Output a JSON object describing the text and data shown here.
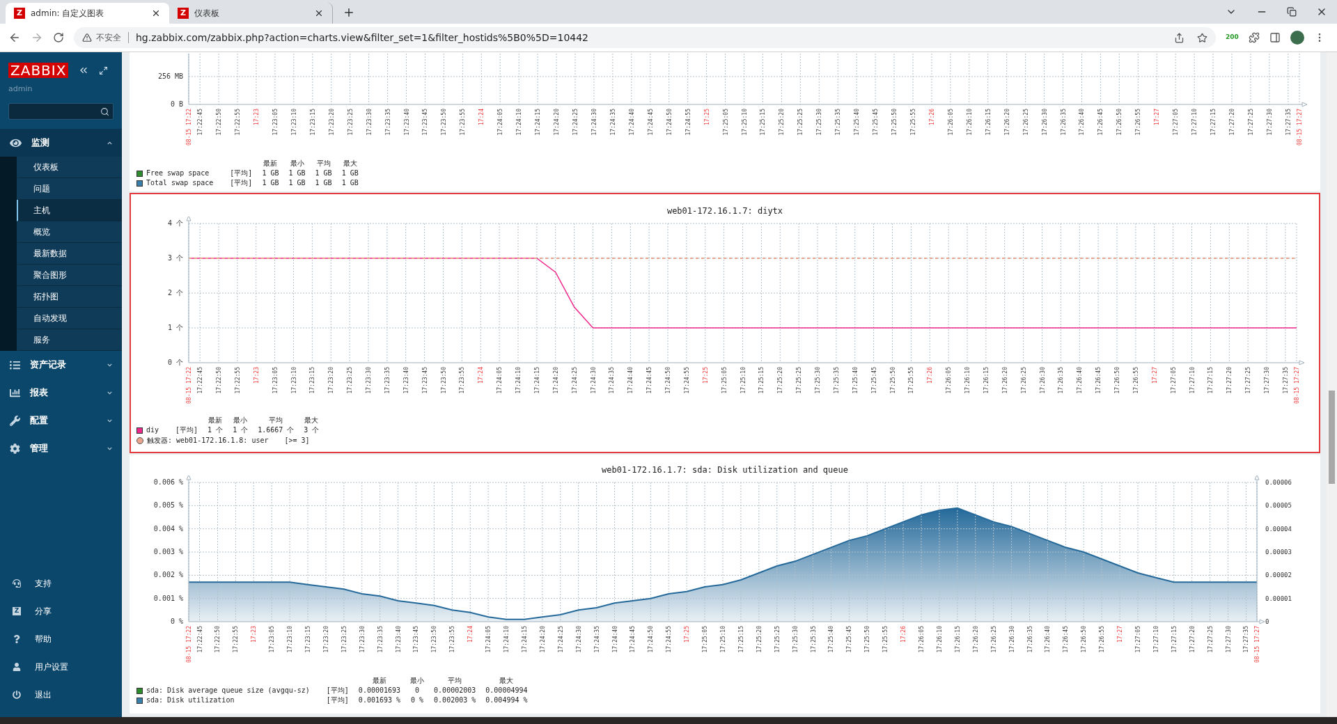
{
  "browser": {
    "tabs": [
      {
        "favicon": "Z",
        "title": "admin: 自定义图表",
        "selected": true
      },
      {
        "favicon": "Z",
        "title": "仪表板",
        "selected": false
      }
    ],
    "security": "不安全",
    "url": "hg.zabbix.com/zabbix.php?action=charts.view&filter_set=1&filter_hostids%5B0%5D=10442",
    "extension_badge": "200"
  },
  "sidebar": {
    "logo": "ZABBIX",
    "user": "admin",
    "sections": [
      {
        "label": "监测",
        "expanded": true,
        "children": [
          {
            "label": "仪表板",
            "selected": false
          },
          {
            "label": "问题",
            "selected": false
          },
          {
            "label": "主机",
            "selected": true
          },
          {
            "label": "概览",
            "selected": false
          },
          {
            "label": "最新数据",
            "selected": false
          },
          {
            "label": "聚合图形",
            "selected": false
          },
          {
            "label": "拓扑图",
            "selected": false
          },
          {
            "label": "自动发现",
            "selected": false
          },
          {
            "label": "服务",
            "selected": false
          }
        ]
      },
      {
        "label": "资产记录",
        "expanded": false
      },
      {
        "label": "报表",
        "expanded": false
      },
      {
        "label": "配置",
        "expanded": false
      },
      {
        "label": "管理",
        "expanded": false
      }
    ],
    "footer": [
      {
        "label": "支持"
      },
      {
        "label": "分享",
        "badge": "Z"
      },
      {
        "label": "帮助"
      },
      {
        "label": "用户设置"
      },
      {
        "label": "退出"
      }
    ]
  },
  "charts": [
    {
      "selected": false,
      "chart_data": {
        "type": "line",
        "grid": true,
        "ylim": [
          0,
          467
        ],
        "yticks": [
          {
            "value": 0,
            "label": "0 B"
          },
          {
            "value": 256,
            "label": "256 MB"
          }
        ],
        "categories": [
          "08-15 17:22",
          "17:22:45",
          "17:22:50",
          "17:22:55",
          "17:23",
          "17:23:05",
          "17:23:10",
          "17:23:15",
          "17:23:20",
          "17:23:25",
          "17:23:30",
          "17:23:35",
          "17:23:40",
          "17:23:45",
          "17:23:50",
          "17:23:55",
          "17:24",
          "17:24:05",
          "17:24:10",
          "17:24:15",
          "17:24:20",
          "17:24:25",
          "17:24:30",
          "17:24:35",
          "17:24:40",
          "17:24:45",
          "17:24:50",
          "17:24:55",
          "17:25",
          "17:25:05",
          "17:25:10",
          "17:25:15",
          "17:25:20",
          "17:25:25",
          "17:25:30",
          "17:25:35",
          "17:25:40",
          "17:25:45",
          "17:25:50",
          "17:25:55",
          "17:26",
          "17:26:05",
          "17:26:10",
          "17:26:15",
          "17:26:20",
          "17:26:25",
          "17:26:30",
          "17:26:35",
          "17:26:40",
          "17:26:45",
          "17:26:50",
          "17:26:55",
          "17:27",
          "17:27:05",
          "17:27:10",
          "17:27:15",
          "17:27:20",
          "17:27:25",
          "17:27:30",
          "17:27:35",
          "08-15 17:27"
        ]
      },
      "legend": {
        "headers": [
          "最新",
          "最小",
          "平均",
          "最大"
        ],
        "rows": [
          {
            "color": "#2e8b2e",
            "name": "Free swap space",
            "func": "[平均]",
            "values": [
              "1 GB",
              "1 GB",
              "1 GB",
              "1 GB"
            ]
          },
          {
            "color": "#3a7eaa",
            "name": "Total swap space",
            "func": "[平均]",
            "values": [
              "1 GB",
              "1 GB",
              "1 GB",
              "1 GB"
            ]
          }
        ]
      }
    },
    {
      "selected": true,
      "title": "web01-172.16.1.7: diytx",
      "chart_data": {
        "type": "line",
        "grid": true,
        "ylim": [
          0,
          4
        ],
        "yticks": [
          {
            "value": 0,
            "label": "0 个"
          },
          {
            "value": 1,
            "label": "1 个"
          },
          {
            "value": 2,
            "label": "2 个"
          },
          {
            "value": 3,
            "label": "3 个"
          },
          {
            "value": 4,
            "label": "4 个"
          }
        ],
        "categories": [
          "08-15 17:22",
          "17:22:45",
          "17:22:50",
          "17:22:55",
          "17:23",
          "17:23:05",
          "17:23:10",
          "17:23:15",
          "17:23:20",
          "17:23:25",
          "17:23:30",
          "17:23:35",
          "17:23:40",
          "17:23:45",
          "17:23:50",
          "17:23:55",
          "17:24",
          "17:24:05",
          "17:24:10",
          "17:24:15",
          "17:24:20",
          "17:24:25",
          "17:24:30",
          "17:24:35",
          "17:24:40",
          "17:24:45",
          "17:24:50",
          "17:24:55",
          "17:25",
          "17:25:05",
          "17:25:10",
          "17:25:15",
          "17:25:20",
          "17:25:25",
          "17:25:30",
          "17:25:35",
          "17:25:40",
          "17:25:45",
          "17:25:50",
          "17:25:55",
          "17:26",
          "17:26:05",
          "17:26:10",
          "17:26:15",
          "17:26:20",
          "17:26:25",
          "17:26:30",
          "17:26:35",
          "17:26:40",
          "17:26:45",
          "17:26:50",
          "17:26:55",
          "17:27",
          "17:27:05",
          "17:27:10",
          "17:27:15",
          "17:27:20",
          "17:27:25",
          "17:27:30",
          "17:27:35",
          "08-15 17:27"
        ],
        "series": [
          {
            "name": "diy",
            "color": "#f0288c",
            "values": [
              3,
              3,
              3,
              3,
              3,
              3,
              3,
              3,
              3,
              3,
              3,
              3,
              3,
              3,
              3,
              3,
              3,
              3,
              3,
              3,
              2.6,
              1.6,
              1,
              1,
              1,
              1,
              1,
              1,
              1,
              1,
              1,
              1,
              1,
              1,
              1,
              1,
              1,
              1,
              1,
              1,
              1,
              1,
              1,
              1,
              1,
              1,
              1,
              1,
              1,
              1,
              1,
              1,
              1,
              1,
              1,
              1,
              1,
              1,
              1,
              1,
              1
            ]
          },
          {
            "color": "#e8a58c",
            "line_style": "dashed",
            "values": [
              3,
              3,
              3,
              3,
              3,
              3,
              3,
              3,
              3,
              3,
              3,
              3,
              3,
              3,
              3,
              3,
              3,
              3,
              3,
              3,
              3,
              3,
              3,
              3,
              3,
              3,
              3,
              3,
              3,
              3,
              3,
              3,
              3,
              3,
              3,
              3,
              3,
              3,
              3,
              3,
              3,
              3,
              3,
              3,
              3,
              3,
              3,
              3,
              3,
              3,
              3,
              3,
              3,
              3,
              3,
              3,
              3,
              3,
              3,
              3,
              3
            ]
          }
        ]
      },
      "legend": {
        "headers": [
          "最新",
          "最小",
          "平均",
          "最大"
        ],
        "rows": [
          {
            "kind": "series",
            "func": "[平均]",
            "values": [
              "1 个",
              "1 个",
              "1.6667 个",
              "3 个"
            ]
          }
        ],
        "trigger": {
          "color": "#e8a58c",
          "text": "触发器: web01-172.16.1.8: user",
          "condition": "[>= 3]"
        }
      }
    },
    {
      "selected": false,
      "title": "web01-172.16.1.7: sda: Disk utilization and queue",
      "chart_data": {
        "type": "area",
        "grid": true,
        "ylim": [
          0,
          0.006
        ],
        "yticks": [
          {
            "value": 0,
            "label": "0 %"
          },
          {
            "value": 0.001,
            "label": "0.001 %"
          },
          {
            "value": 0.002,
            "label": "0.002 %"
          },
          {
            "value": 0.003,
            "label": "0.003 %"
          },
          {
            "value": 0.004,
            "label": "0.004 %"
          },
          {
            "value": 0.005,
            "label": "0.005 %"
          },
          {
            "value": 0.006,
            "label": "0.006 %"
          }
        ],
        "y2lim": [
          0,
          6e-05
        ],
        "y2ticks": [
          {
            "value": 0,
            "label": "0"
          },
          {
            "value": 1e-05,
            "label": "0.00001"
          },
          {
            "value": 2e-05,
            "label": "0.00002"
          },
          {
            "value": 3e-05,
            "label": "0.00003"
          },
          {
            "value": 4e-05,
            "label": "0.00004"
          },
          {
            "value": 5e-05,
            "label": "0.00005"
          },
          {
            "value": 6e-05,
            "label": "0.00006"
          }
        ],
        "categories": [
          "08-15 17:22",
          "17:22:45",
          "17:22:50",
          "17:22:55",
          "17:23",
          "17:23:05",
          "17:23:10",
          "17:23:15",
          "17:23:20",
          "17:23:25",
          "17:23:30",
          "17:23:35",
          "17:23:40",
          "17:23:45",
          "17:23:50",
          "17:23:55",
          "17:24",
          "17:24:05",
          "17:24:10",
          "17:24:15",
          "17:24:20",
          "17:24:25",
          "17:24:30",
          "17:24:35",
          "17:24:40",
          "17:24:45",
          "17:24:50",
          "17:24:55",
          "17:25",
          "17:25:05",
          "17:25:10",
          "17:25:15",
          "17:25:20",
          "17:25:25",
          "17:25:30",
          "17:25:35",
          "17:25:40",
          "17:25:45",
          "17:25:50",
          "17:25:55",
          "17:26",
          "17:26:05",
          "17:26:10",
          "17:26:15",
          "17:26:20",
          "17:26:25",
          "17:26:30",
          "17:26:35",
          "17:26:40",
          "17:26:45",
          "17:26:50",
          "17:26:55",
          "17:27",
          "17:27:05",
          "17:27:10",
          "17:27:15",
          "17:27:20",
          "17:27:25",
          "17:27:30",
          "17:27:35",
          "08-15 17:27"
        ],
        "series": [
          {
            "name": "sda: Disk utilization",
            "color": "#24699a",
            "values": [
              0.0017,
              0.0017,
              0.0017,
              0.0017,
              0.0017,
              0.0017,
              0.0017,
              0.0016,
              0.0015,
              0.0014,
              0.0012,
              0.0011,
              0.0009,
              0.0008,
              0.0007,
              0.0005,
              0.0004,
              0.0002,
              0.0001,
              0.0001,
              0.0002,
              0.0003,
              0.0005,
              0.0006,
              0.0008,
              0.0009,
              0.001,
              0.0012,
              0.0013,
              0.0015,
              0.0016,
              0.0018,
              0.0021,
              0.0024,
              0.0026,
              0.0029,
              0.0032,
              0.0035,
              0.0037,
              0.004,
              0.0043,
              0.0046,
              0.0048,
              0.0049,
              0.0046,
              0.0043,
              0.0041,
              0.0038,
              0.0035,
              0.0032,
              0.003,
              0.0027,
              0.0024,
              0.0021,
              0.0019,
              0.0017,
              0.0017,
              0.0017,
              0.0017,
              0.0017,
              0.0017
            ]
          }
        ]
      },
      "legend": {
        "headers": [
          "最新",
          "最小",
          "平均",
          "最大"
        ],
        "rows": [
          {
            "color": "#2e8b2e",
            "name": "sda: Disk average queue size (avgqu-sz)",
            "func": "[平均]",
            "values": [
              "0.00001693",
              "0",
              "0.00002003",
              "0.00004994"
            ]
          },
          {
            "color": "#3a7eaa",
            "kind": "series",
            "func": "[平均]",
            "values": [
              "0.001693 %",
              "0 %",
              "0.002003 %",
              "0.004994 %"
            ]
          }
        ]
      }
    }
  ]
}
